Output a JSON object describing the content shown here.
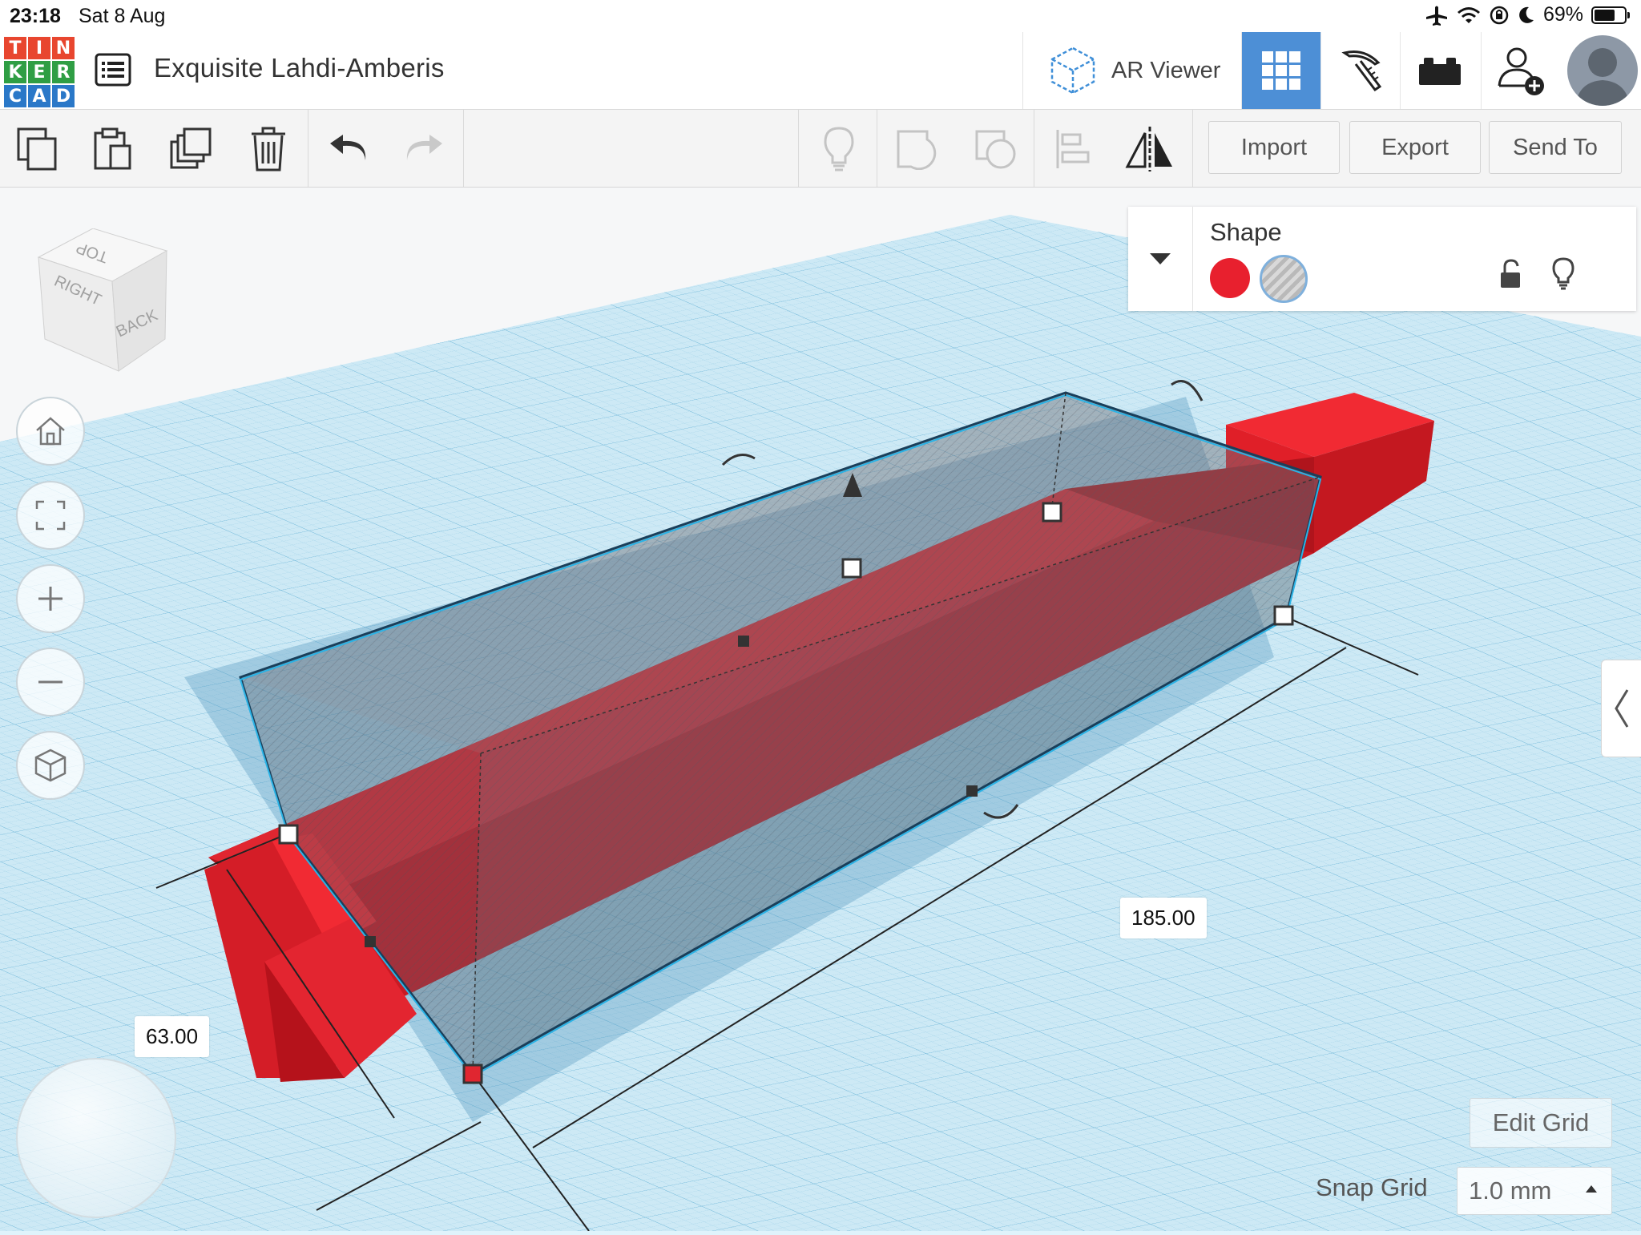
{
  "status_bar": {
    "time": "23:18",
    "date": "Sat 8 Aug",
    "battery_text": "69%",
    "battery_level": 0.69
  },
  "app": {
    "logo_letters": [
      "T",
      "I",
      "N",
      "K",
      "E",
      "R",
      "C",
      "A",
      "D"
    ],
    "logo_colors": [
      "#e8462f",
      "#e8462f",
      "#e8462f",
      "#2f9e44",
      "#2f9e44",
      "#2f9e44",
      "#2a78c8",
      "#2a78c8",
      "#2a78c8"
    ],
    "document_title": "Exquisite Lahdi-Amberis",
    "ar_viewer_label": "AR Viewer",
    "accent_color": "#4d8fd6"
  },
  "top_bar": {
    "buttons": [
      {
        "name": "3d-design-view",
        "icon": "grid-icon",
        "active": true
      },
      {
        "name": "blocks-view",
        "icon": "pickaxe-icon",
        "active": false
      },
      {
        "name": "bricks-view",
        "icon": "brick-icon",
        "active": false
      },
      {
        "name": "invite-user",
        "icon": "add-user-icon",
        "active": false
      }
    ]
  },
  "toolbar": {
    "left_tools": [
      "copy-icon",
      "paste-icon",
      "duplicate-icon",
      "delete-icon",
      "undo-icon",
      "redo-icon"
    ],
    "right_tools": [
      "lightbulb-icon",
      "group-icon",
      "ungroup-icon",
      "align-icon",
      "mirror-icon"
    ],
    "import_label": "Import",
    "export_label": "Export",
    "send_to_label": "Send To"
  },
  "view_cube": {
    "top": "TOP",
    "right": "RIGHT",
    "back": "BACK"
  },
  "shape_panel": {
    "title": "Shape",
    "solid_color": "#e8202e",
    "hole_selected": true
  },
  "dimensions": {
    "length": "185.00",
    "width": "63.00"
  },
  "grid": {
    "edit_grid_label": "Edit Grid",
    "snap_grid_label": "Snap Grid",
    "snap_grid_value": "1.0 mm"
  }
}
